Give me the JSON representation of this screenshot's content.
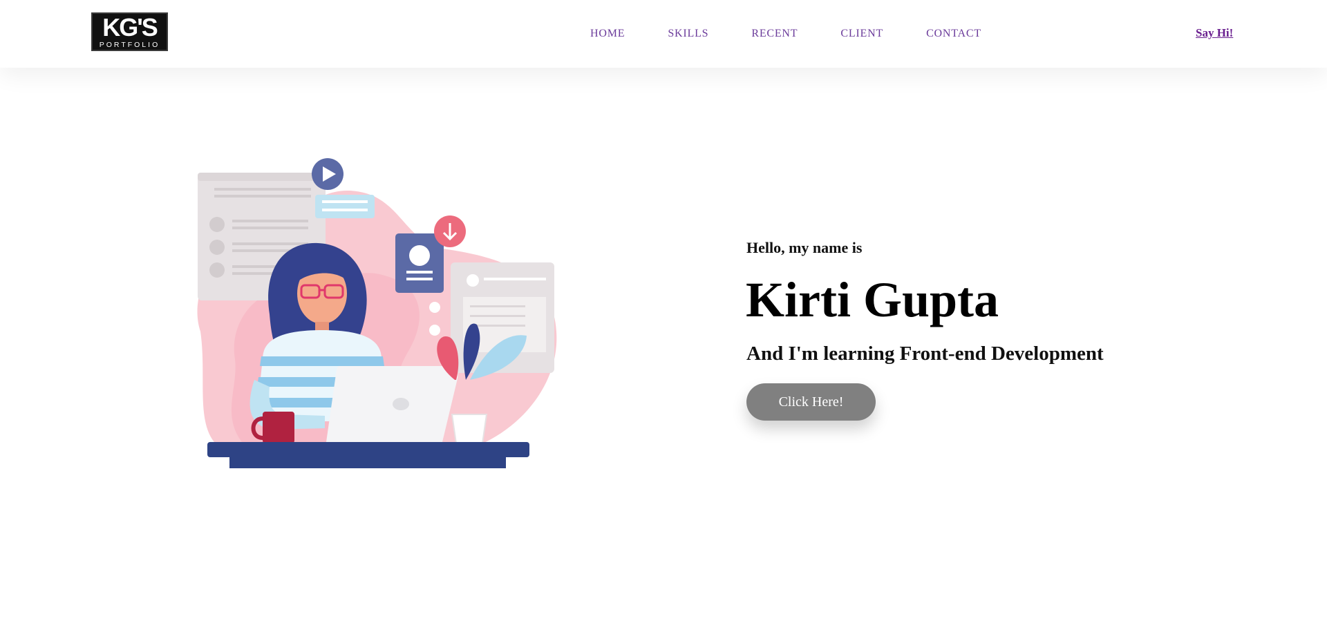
{
  "header": {
    "logo": {
      "main": "KG'S",
      "sub": "PORTFOLIO"
    },
    "nav": [
      {
        "label": "HOME"
      },
      {
        "label": "SKILLS"
      },
      {
        "label": "RECENT"
      },
      {
        "label": "CLIENT"
      },
      {
        "label": "CONTACT"
      }
    ],
    "cta_link": "Say Hi!"
  },
  "hero": {
    "illustration": "woman-working-at-laptop-illustration",
    "intro": "Hello, my name is",
    "name": "Kirti Gupta",
    "tagline": "And I'm learning Front-end Development",
    "button": "Click Here!"
  },
  "colors": {
    "nav_link": "#6a3a9a",
    "say_hi": "#6a1f8f",
    "button_bg": "#808080",
    "desk": "#2e4385",
    "blob": "#f9c9d1"
  }
}
